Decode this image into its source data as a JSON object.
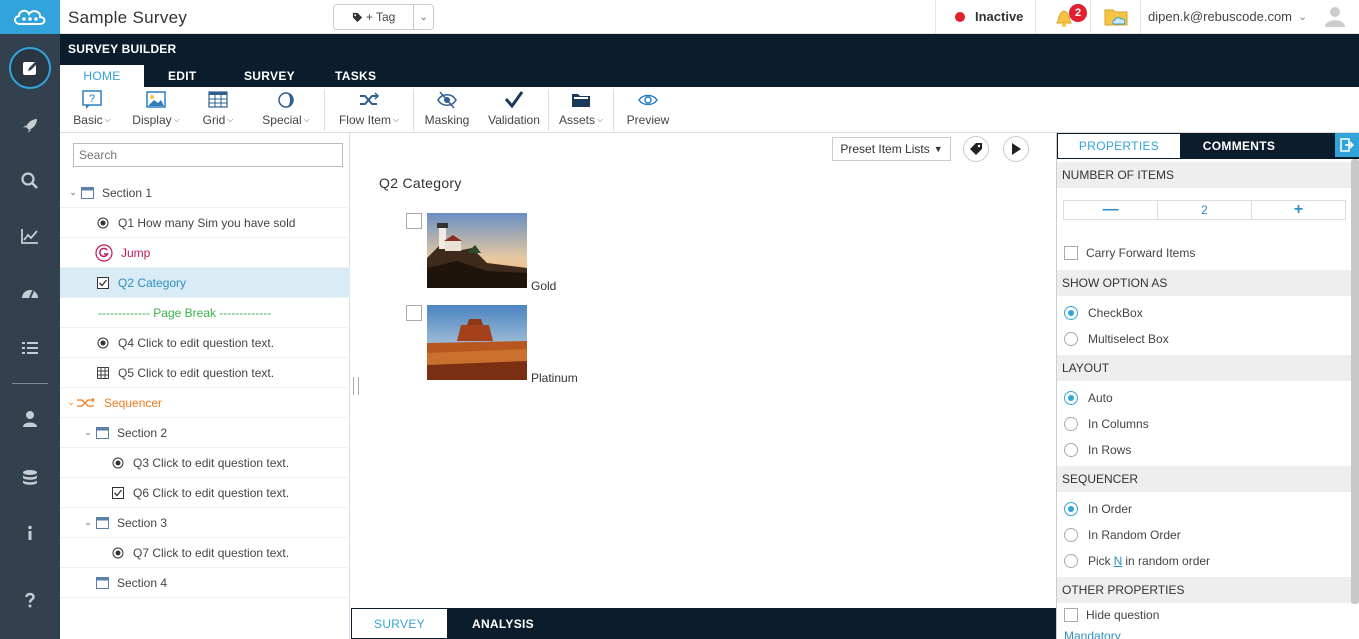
{
  "app": {
    "title": "Sample Survey",
    "brand_color": "#33a3dc",
    "dark_color": "#0b1d2c"
  },
  "topbar": {
    "tag_label": "+ Tag",
    "status": "Inactive",
    "notification_count": "2",
    "user_email": "dipen.k@rebuscode.com"
  },
  "builder": {
    "header": "SURVEY BUILDER",
    "tabs": [
      {
        "label": "HOME",
        "active": true
      },
      {
        "label": "EDIT"
      },
      {
        "label": "SURVEY"
      },
      {
        "label": "TASKS"
      }
    ]
  },
  "ribbon": {
    "basic": "Basic",
    "display": "Display",
    "grid": "Grid",
    "special": "Special",
    "flow_item": "Flow Item",
    "masking": "Masking",
    "validation": "Validation",
    "assets": "Assets",
    "preview": "Preview"
  },
  "tree": {
    "search_placeholder": "Search",
    "items": [
      {
        "label": "Section 1",
        "type": "section"
      },
      {
        "label": "Q1 How many Sim you have sold",
        "type": "radio"
      },
      {
        "label": "Jump",
        "type": "jump"
      },
      {
        "label": "Q2 Category",
        "type": "checkbox",
        "selected": true
      },
      {
        "label": "------------- Page Break -------------",
        "type": "pagebreak"
      },
      {
        "label": "Q4 Click to edit question text.",
        "type": "radio"
      },
      {
        "label": "Q5 Click to edit question text.",
        "type": "grid"
      },
      {
        "label": "Sequencer",
        "type": "sequencer"
      },
      {
        "label": "Section 2",
        "type": "section"
      },
      {
        "label": "Q3 Click to edit question text.",
        "type": "radio"
      },
      {
        "label": "Q6 Click to edit question text.",
        "type": "checkbox"
      },
      {
        "label": "Section 3",
        "type": "section"
      },
      {
        "label": "Q7 Click to edit question text.",
        "type": "radio"
      },
      {
        "label": "Section 4",
        "type": "section"
      }
    ]
  },
  "center": {
    "preset_label": "Preset Item Lists",
    "question_title": "Q2  Category",
    "options": [
      {
        "label": "Gold",
        "image": "lighthouse"
      },
      {
        "label": "Platinum",
        "image": "desert-butte"
      }
    ]
  },
  "bottom_tabs": [
    {
      "label": "SURVEY",
      "active": true
    },
    {
      "label": "ANALYSIS"
    }
  ],
  "properties": {
    "tabs": [
      {
        "label": "PROPERTIES",
        "active": true
      },
      {
        "label": "COMMENTS"
      }
    ],
    "number_of_items_header": "NUMBER OF ITEMS",
    "number_of_items": "2",
    "carry_forward": "Carry Forward Items",
    "show_option_header": "SHOW OPTION AS",
    "show_option_checkbox": "CheckBox",
    "show_option_multiselect": "Multiselect Box",
    "layout_header": "LAYOUT",
    "layout_auto": "Auto",
    "layout_columns": "In Columns",
    "layout_rows": "In Rows",
    "sequencer_header": "SEQUENCER",
    "seq_in_order": "In Order",
    "seq_random": "In Random Order",
    "seq_pick_prefix": "Pick",
    "seq_pick_n": "N",
    "seq_pick_suffix": "in random order",
    "other_header": "OTHER PROPERTIES",
    "hide_question": "Hide question",
    "mandatory": "Mandatory"
  }
}
